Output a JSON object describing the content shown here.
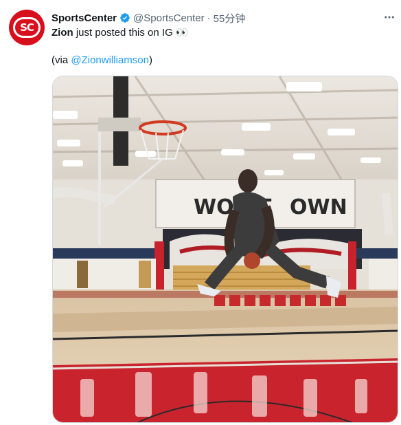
{
  "tweet": {
    "author": {
      "name": "SportsCenter",
      "handle": "@SportsCenter",
      "verified": true,
      "avatar_icon": "sportscenter-logo-avatar",
      "avatar_text": "SC",
      "avatar_color": "#d8101d"
    },
    "separator": "·",
    "timestamp": "55分钟",
    "text": {
      "subject": "Zion",
      "body": " just posted this on IG ",
      "emoji": "👀",
      "via_prefix": "(via ",
      "mention": "@Zionwilliamson",
      "via_suffix": ")"
    },
    "media": {
      "type": "video-thumbnail",
      "banner_text_left": "WON'T",
      "banner_text_right": "OWN"
    },
    "colors": {
      "link": "#1d9bf0",
      "verified": "#1d9bf0",
      "secondary_text": "#536471"
    }
  }
}
